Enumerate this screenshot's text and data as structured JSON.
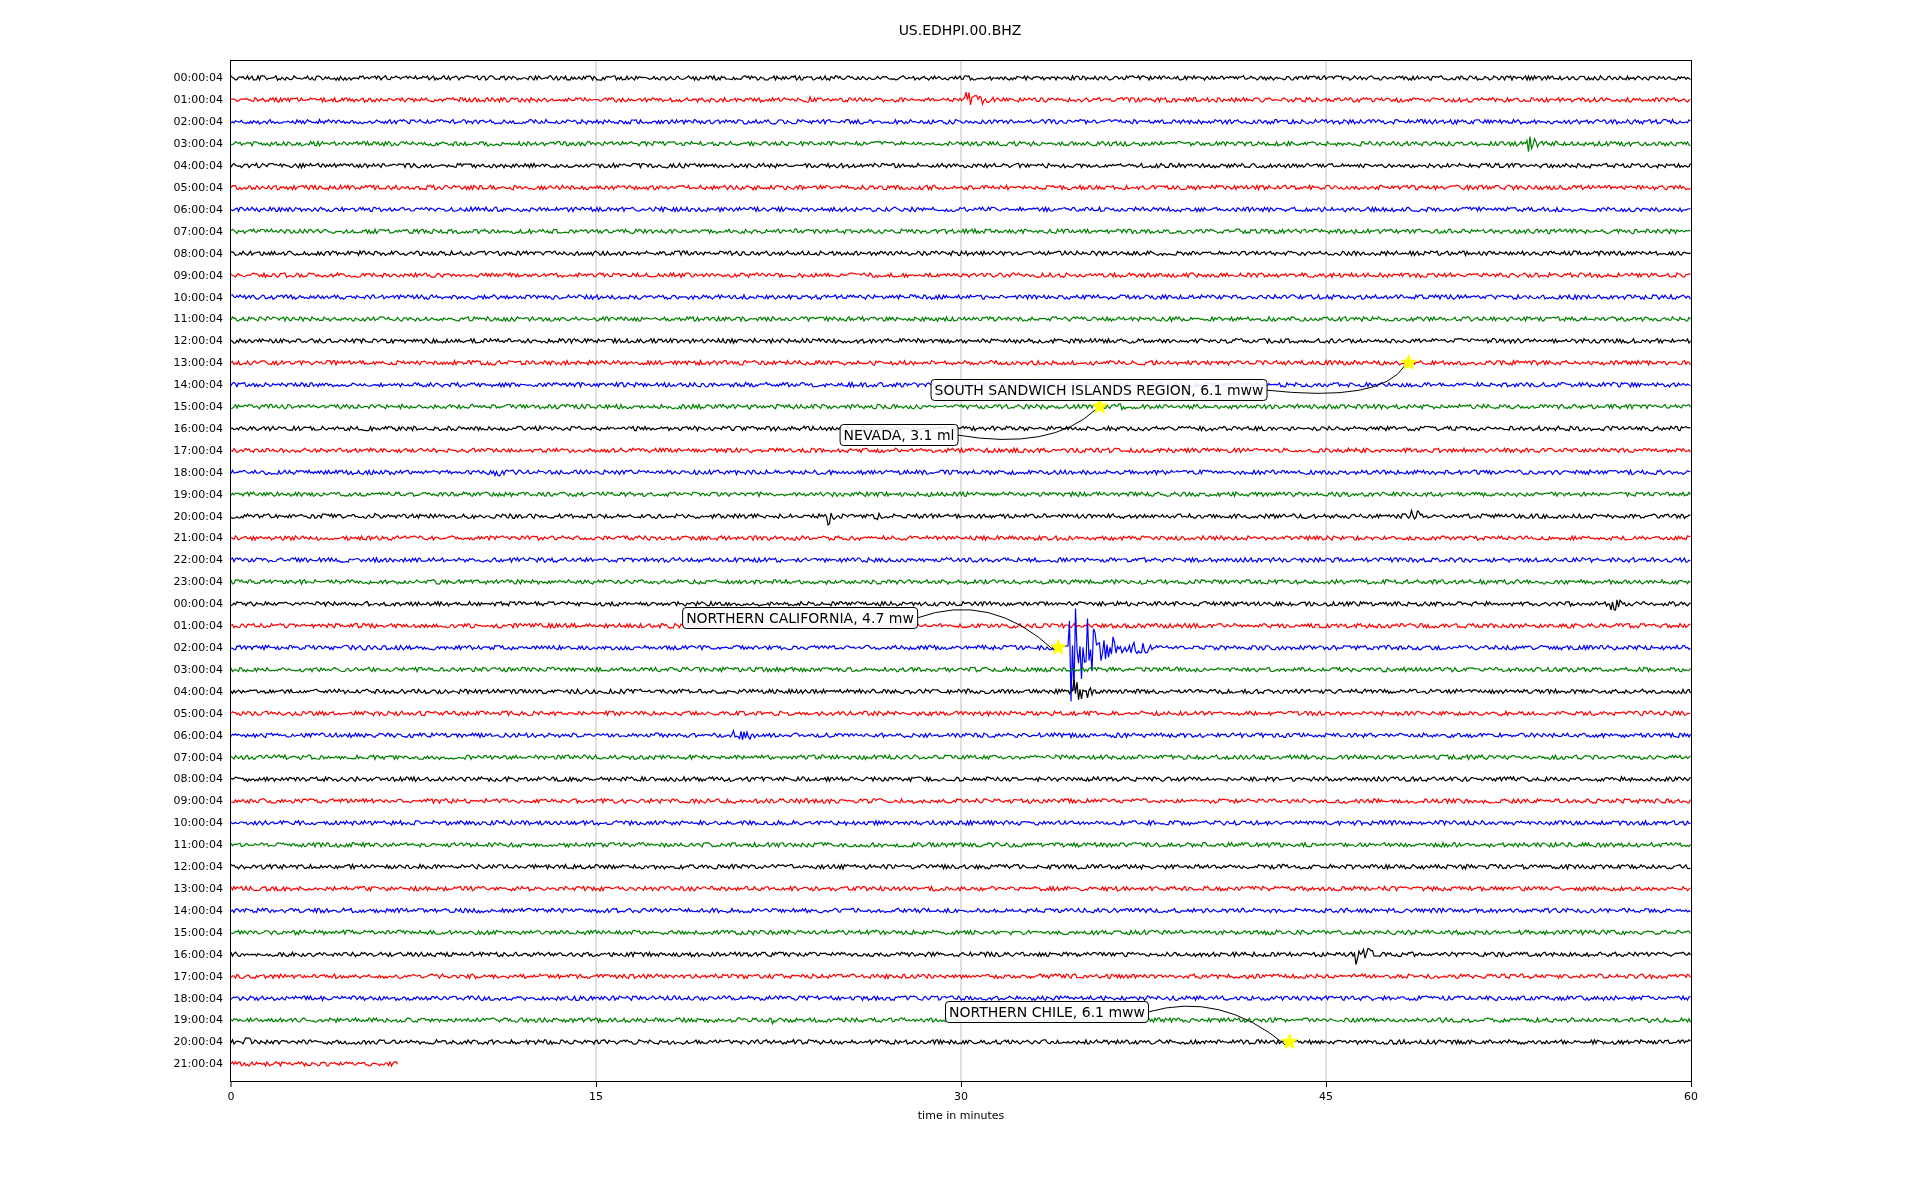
{
  "title": "US.EDHPI.00.BHZ",
  "rows": [
    {
      "label": "00:00:04",
      "color": "#000000",
      "level": 1
    },
    {
      "label": "01:00:04",
      "color": "#ff0000",
      "level": 1
    },
    {
      "label": "02:00:04",
      "color": "#0000ff",
      "level": 1
    },
    {
      "label": "03:00:04",
      "color": "#008000",
      "level": 1
    },
    {
      "label": "04:00:04",
      "color": "#000000",
      "level": 1
    },
    {
      "label": "05:00:04",
      "color": "#ff0000",
      "level": 1
    },
    {
      "label": "06:00:04",
      "color": "#0000ff",
      "level": 1
    },
    {
      "label": "07:00:04",
      "color": "#008000",
      "level": 1
    },
    {
      "label": "08:00:04",
      "color": "#000000",
      "level": 1
    },
    {
      "label": "09:00:04",
      "color": "#ff0000",
      "level": 1
    },
    {
      "label": "10:00:04",
      "color": "#0000ff",
      "level": 1
    },
    {
      "label": "11:00:04",
      "color": "#008000",
      "level": 1
    },
    {
      "label": "12:00:04",
      "color": "#000000",
      "level": 1
    },
    {
      "label": "13:00:04",
      "color": "#ff0000",
      "level": 1
    },
    {
      "label": "14:00:04",
      "color": "#0000ff",
      "level": 1
    },
    {
      "label": "15:00:04",
      "color": "#008000",
      "level": 1
    },
    {
      "label": "16:00:04",
      "color": "#000000",
      "level": 1
    },
    {
      "label": "17:00:04",
      "color": "#ff0000",
      "level": 1
    },
    {
      "label": "18:00:04",
      "color": "#0000ff",
      "level": 1
    },
    {
      "label": "19:00:04",
      "color": "#008000",
      "level": 1
    },
    {
      "label": "20:00:04",
      "color": "#000000",
      "level": 1
    },
    {
      "label": "21:00:04",
      "color": "#ff0000",
      "level": 1
    },
    {
      "label": "22:00:04",
      "color": "#0000ff",
      "level": 1
    },
    {
      "label": "23:00:04",
      "color": "#008000",
      "level": 1
    },
    {
      "label": "00:00:04",
      "color": "#000000",
      "level": 1
    },
    {
      "label": "01:00:04",
      "color": "#ff0000",
      "level": 1
    },
    {
      "label": "02:00:04",
      "color": "#0000ff",
      "level": 1
    },
    {
      "label": "03:00:04",
      "color": "#008000",
      "level": 1
    },
    {
      "label": "04:00:04",
      "color": "#000000",
      "level": 1
    },
    {
      "label": "05:00:04",
      "color": "#ff0000",
      "level": 1
    },
    {
      "label": "06:00:04",
      "color": "#0000ff",
      "level": 1
    },
    {
      "label": "07:00:04",
      "color": "#008000",
      "level": 1
    },
    {
      "label": "08:00:04",
      "color": "#000000",
      "level": 1
    },
    {
      "label": "09:00:04",
      "color": "#ff0000",
      "level": 1
    },
    {
      "label": "10:00:04",
      "color": "#0000ff",
      "level": 1
    },
    {
      "label": "11:00:04",
      "color": "#008000",
      "level": 1
    },
    {
      "label": "12:00:04",
      "color": "#000000",
      "level": 1
    },
    {
      "label": "13:00:04",
      "color": "#ff0000",
      "level": 1
    },
    {
      "label": "14:00:04",
      "color": "#0000ff",
      "level": 1
    },
    {
      "label": "15:00:04",
      "color": "#008000",
      "level": 1
    },
    {
      "label": "16:00:04",
      "color": "#000000",
      "level": 1
    },
    {
      "label": "17:00:04",
      "color": "#ff0000",
      "level": 1
    },
    {
      "label": "18:00:04",
      "color": "#0000ff",
      "level": 1
    },
    {
      "label": "19:00:04",
      "color": "#008000",
      "level": 1
    },
    {
      "label": "20:00:04",
      "color": "#000000",
      "level": 1
    },
    {
      "label": "21:00:04",
      "color": "#ff0000",
      "level": 0.115
    }
  ],
  "xticks": [
    "0",
    "15",
    "30",
    "45",
    "60"
  ],
  "xlabel": "time in minutes",
  "events": [
    {
      "label": "SOUTH SANDWICH ISLANDS REGION, 6.1 mww"
    },
    {
      "label": "NEVADA, 3.1 ml"
    },
    {
      "label": "NORTHERN CALIFORNIA, 4.7 mw"
    },
    {
      "label": "NORTHERN CHILE, 6.1 mww"
    }
  ]
}
